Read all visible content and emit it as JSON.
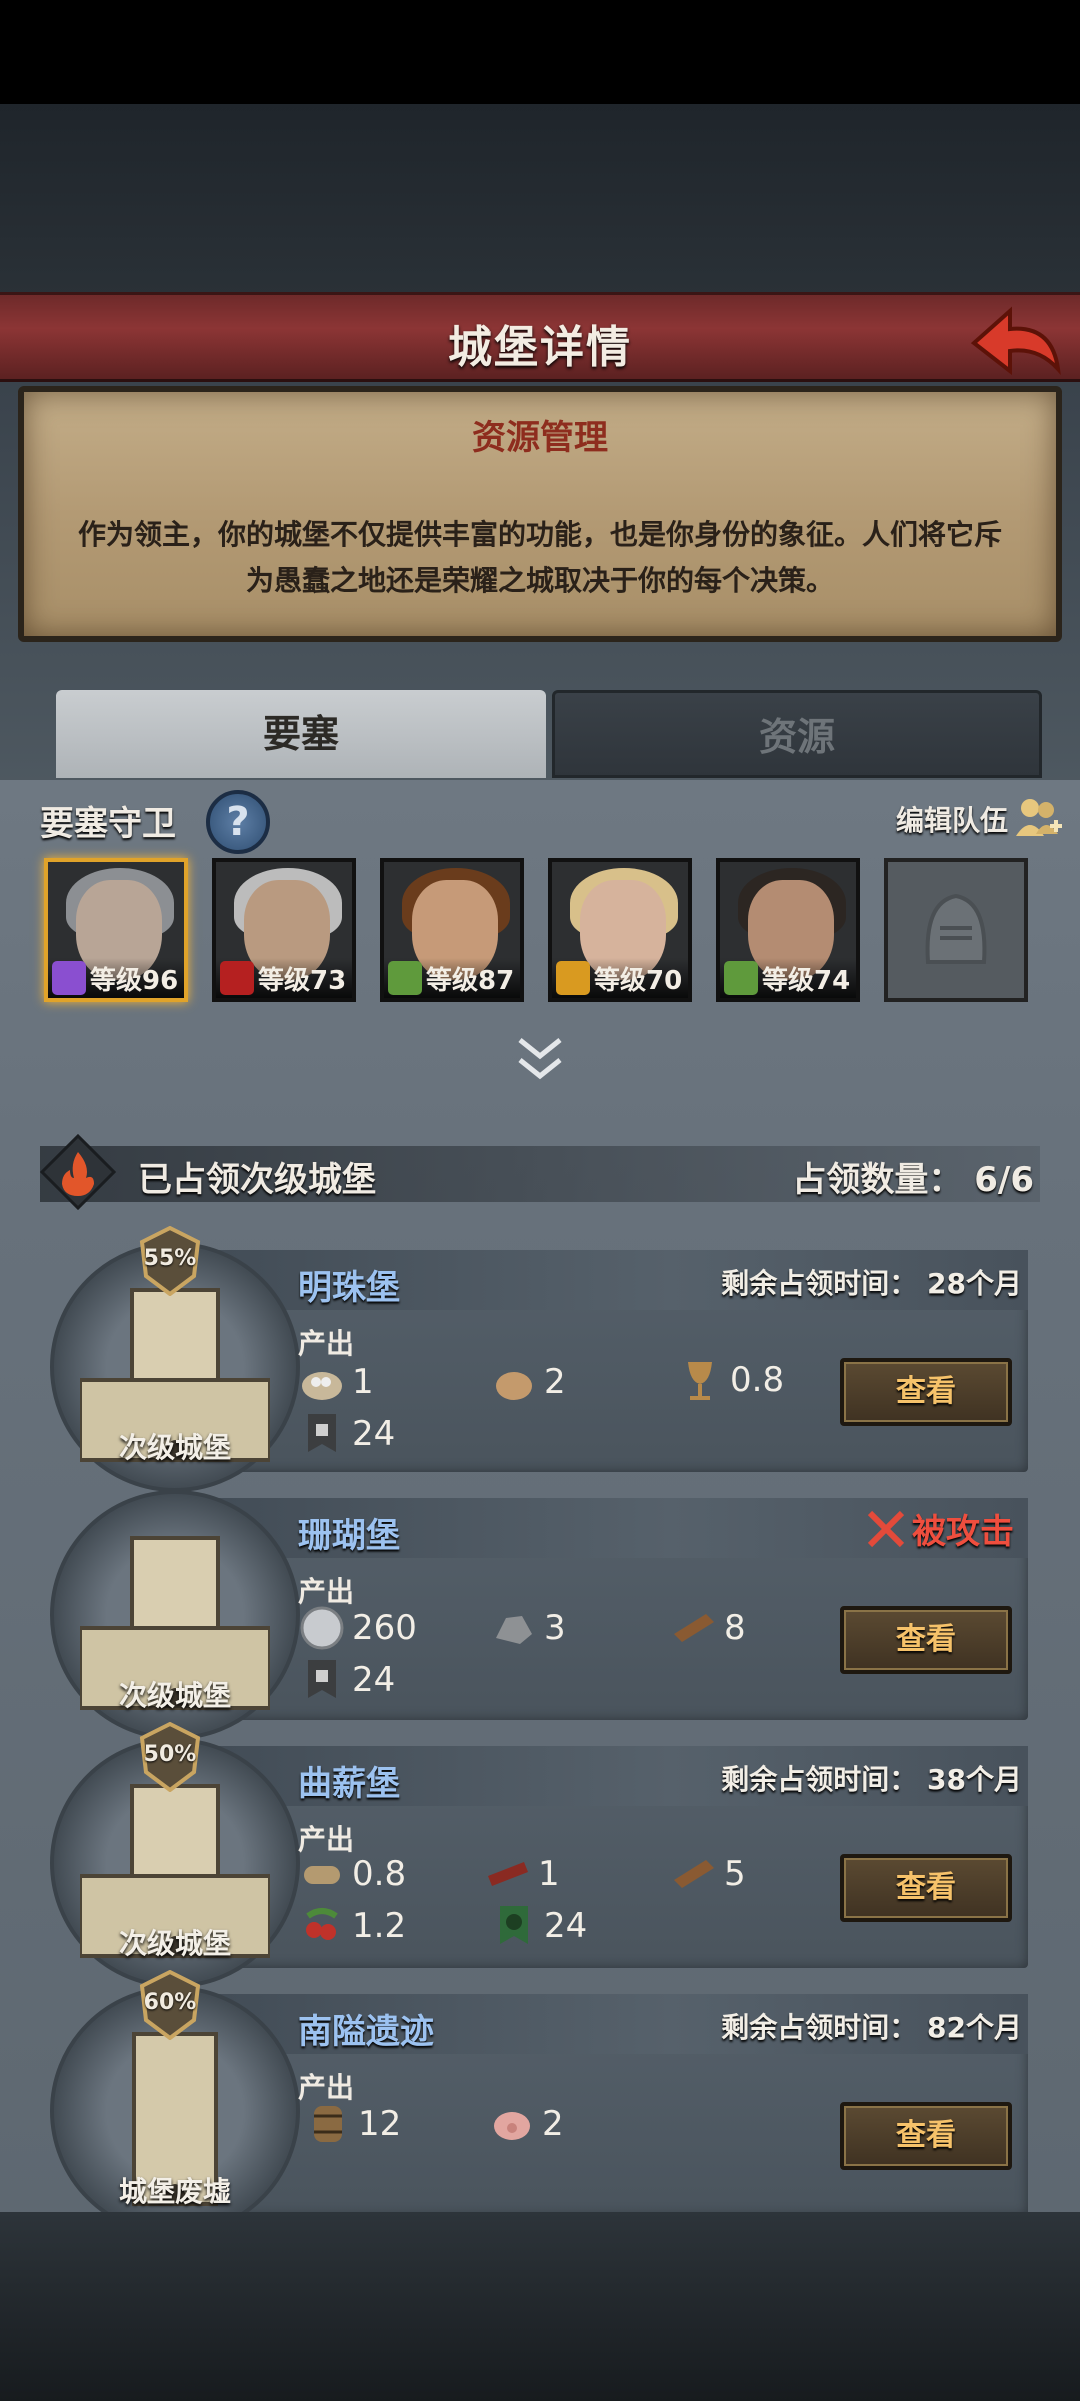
{
  "header": {
    "title": "城堡详情"
  },
  "info": {
    "subtitle": "资源管理",
    "description": "作为领主，你的城堡不仅提供丰富的功能，也是你身份的象征。人们将它斥为愚蠢之地还是荣耀之城取决于你的每个决策。"
  },
  "tabs": [
    {
      "label": "要塞",
      "active": true
    },
    {
      "label": "资源",
      "active": false
    }
  ],
  "guards": {
    "title": "要塞守卫",
    "help": "?",
    "edit_team": "编辑队伍",
    "heroes": [
      {
        "level": "等级96",
        "class_color": "#8a4fd0",
        "selected": true
      },
      {
        "level": "等级73",
        "class_color": "#b52020",
        "selected": false
      },
      {
        "level": "等级87",
        "class_color": "#5f9a3c",
        "selected": false
      },
      {
        "level": "等级70",
        "class_color": "#d99a20",
        "selected": false
      },
      {
        "level": "等级74",
        "class_color": "#5f9a3c",
        "selected": false
      }
    ]
  },
  "occupied": {
    "title": "已占领次级城堡",
    "count_label": "占领数量： 6/6"
  },
  "castles": [
    {
      "name": "明珠堡",
      "badge": "55%",
      "type": "次级城堡",
      "status_label": "剩余占领时间：",
      "months": "28",
      "months_unit": "个月",
      "output_label": "产出",
      "resources": [
        {
          "icon": "pearl-sack-icon",
          "value": "1"
        },
        {
          "icon": "bag-icon",
          "value": "2"
        },
        {
          "icon": "goblet-icon",
          "value": "0.8"
        },
        {
          "icon": "banner-icon",
          "value": "24"
        }
      ],
      "button": "查看"
    },
    {
      "name": "珊瑚堡",
      "type": "次级城堡",
      "attacked": "被攻击",
      "output_label": "产出",
      "resources": [
        {
          "icon": "silver-coin-icon",
          "value": "260"
        },
        {
          "icon": "stone-icon",
          "value": "3"
        },
        {
          "icon": "plank-icon",
          "value": "8"
        },
        {
          "icon": "banner-icon",
          "value": "24"
        }
      ],
      "button": "查看"
    },
    {
      "name": "曲薪堡",
      "badge": "50%",
      "type": "次级城堡",
      "status_label": "剩余占领时间：",
      "months": "38",
      "months_unit": "个月",
      "output_label": "产出",
      "resources": [
        {
          "icon": "log-icon",
          "value": "0.8"
        },
        {
          "icon": "red-wood-icon",
          "value": "1"
        },
        {
          "icon": "plank-icon",
          "value": "5"
        },
        {
          "icon": "berry-icon",
          "value": "1.2"
        },
        {
          "icon": "tree-banner-icon",
          "value": "24"
        }
      ],
      "button": "查看"
    },
    {
      "name": "南隘遗迹",
      "badge": "60%",
      "type": "城堡废墟",
      "status_label": "剩余占领时间：",
      "months": "82",
      "months_unit": "个月",
      "output_label": "产出",
      "resources": [
        {
          "icon": "barrel-icon",
          "value": "12"
        },
        {
          "icon": "pig-icon",
          "value": "2"
        }
      ],
      "button": "查看"
    }
  ]
}
